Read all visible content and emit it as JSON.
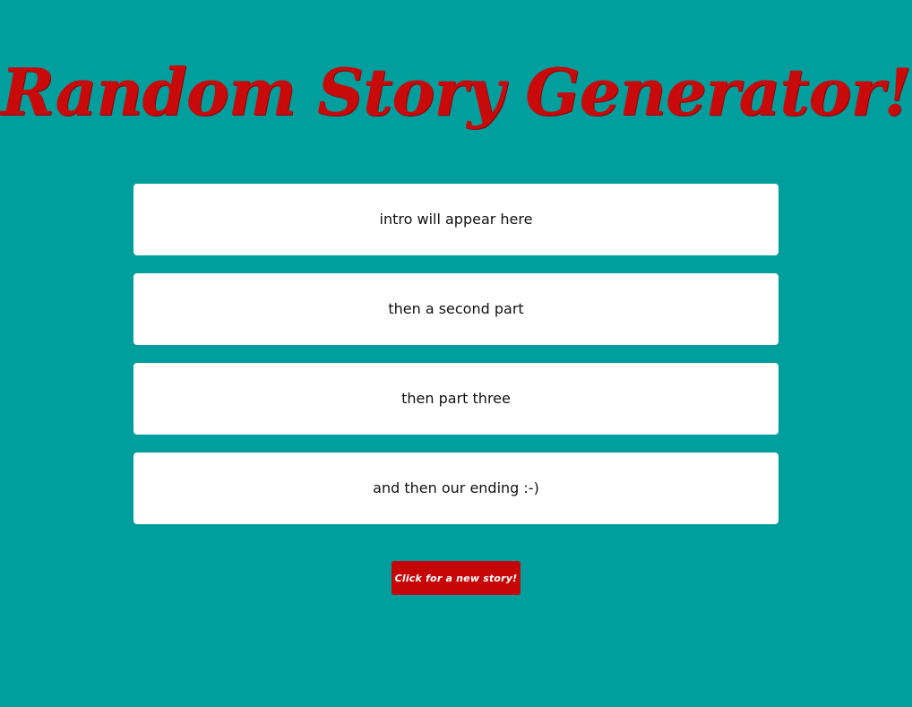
{
  "page": {
    "title": "Random Story Generator!",
    "background_color": "#009e9c",
    "title_color": "#c90a0a",
    "button_color": "#c60606"
  },
  "story": {
    "parts": [
      {
        "text": "intro will appear here"
      },
      {
        "text": "then a second part"
      },
      {
        "text": "then part three"
      },
      {
        "text": "and then our ending :-)"
      }
    ]
  },
  "controls": {
    "new_story_label": "Click for a new story!"
  }
}
